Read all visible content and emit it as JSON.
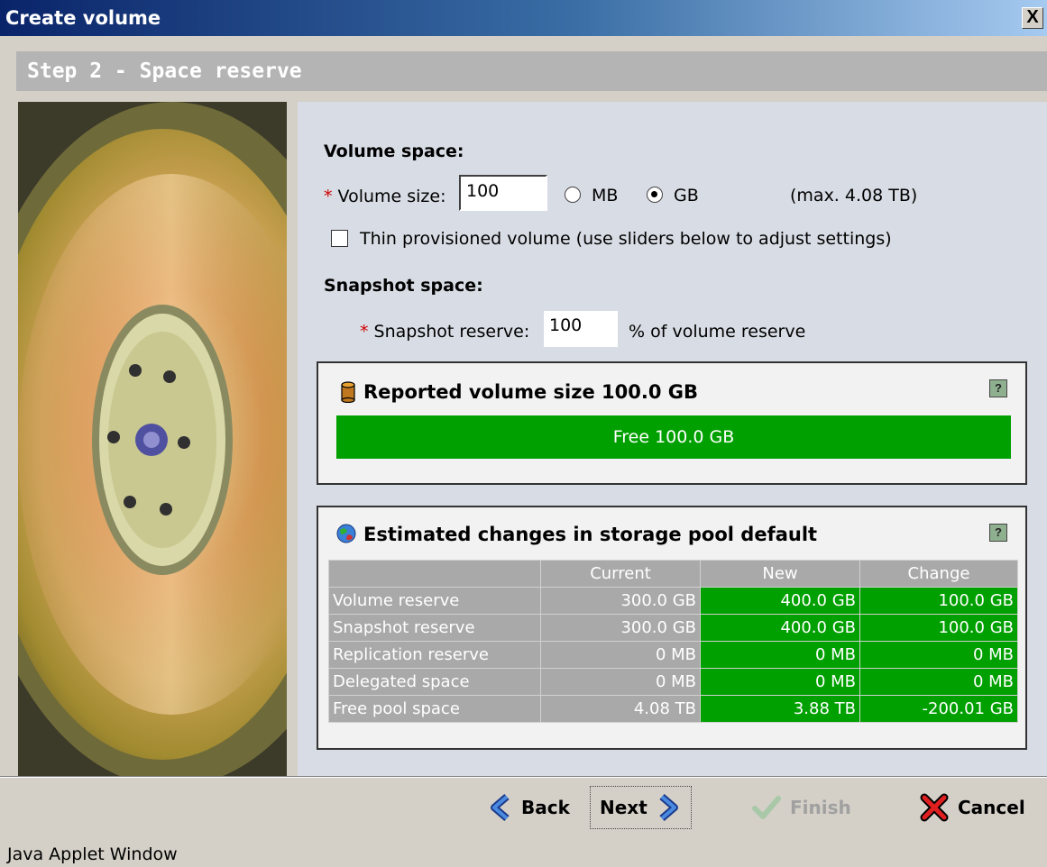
{
  "window": {
    "title": "Create volume",
    "close_glyph": "X"
  },
  "step": {
    "title": "Step 2 - Space reserve"
  },
  "volume_space": {
    "heading": "Volume space:",
    "required_mark": "*",
    "size_label": "Volume size:",
    "size_value": "100",
    "unit_mb": "MB",
    "unit_gb": "GB",
    "selected_unit": "GB",
    "max_text": "(max. 4.08 TB)",
    "thin_label": "Thin provisioned volume (use sliders below to adjust settings)",
    "thin_checked": false
  },
  "snapshot_space": {
    "heading": "Snapshot space:",
    "required_mark": "*",
    "reserve_label": "Snapshot reserve:",
    "reserve_value": "100",
    "reserve_suffix": "% of volume reserve"
  },
  "reported_panel": {
    "icon": "database-icon",
    "title": "Reported volume size 100.0 GB",
    "help": "?",
    "bar_label": "Free 100.0 GB",
    "free_fraction": 1.0,
    "colors": {
      "free": "#00a000"
    }
  },
  "estimated_panel": {
    "icon": "globe-icon",
    "title": "Estimated changes in storage pool default",
    "help": "?",
    "columns": [
      "",
      "Current",
      "New",
      "Change"
    ],
    "rows": [
      {
        "label": "Volume reserve",
        "current": "300.0 GB",
        "new": "400.0 GB",
        "change": "100.0 GB"
      },
      {
        "label": "Snapshot reserve",
        "current": "300.0 GB",
        "new": "400.0 GB",
        "change": "100.0 GB"
      },
      {
        "label": "Replication reserve",
        "current": "0 MB",
        "new": "0 MB",
        "change": "0 MB"
      },
      {
        "label": "Delegated space",
        "current": "0 MB",
        "new": "0 MB",
        "change": "0 MB"
      },
      {
        "label": "Free pool space",
        "current": "4.08 TB",
        "new": "3.88 TB",
        "change": "-200.01 GB"
      }
    ],
    "colors": {
      "header": "#a9a9a9",
      "changed": "#00a000"
    }
  },
  "buttons": {
    "back": "Back",
    "next": "Next",
    "finish": "Finish",
    "cancel": "Cancel"
  },
  "statusbar": {
    "text": "Java Applet Window"
  }
}
